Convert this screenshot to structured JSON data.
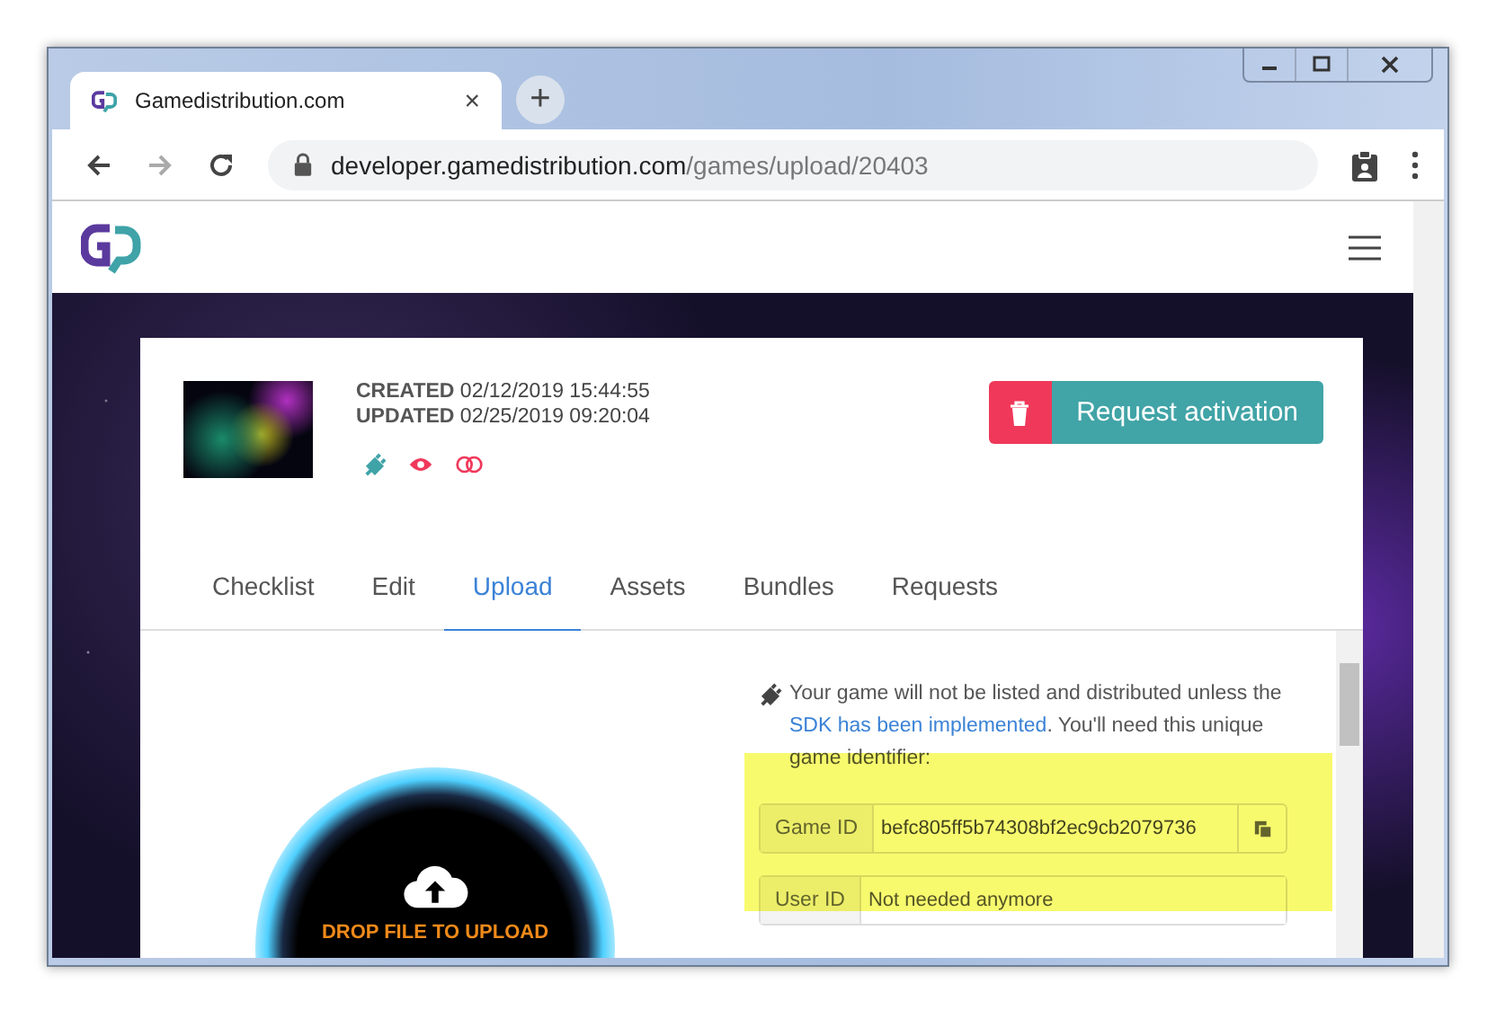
{
  "browser": {
    "tab_title": "Gamedistribution.com",
    "tab_close": "×",
    "new_tab": "+",
    "url_host": "developer.gamedistribution.com",
    "url_path": "/games/upload/20403"
  },
  "game": {
    "created_label": "CREATED",
    "created": "02/12/2019 15:44:55",
    "updated_label": "UPDATED",
    "updated": "02/25/2019 09:20:04",
    "request_button": "Request activation"
  },
  "tabs": [
    {
      "label": "Checklist",
      "selected": false
    },
    {
      "label": "Edit",
      "selected": false
    },
    {
      "label": "Upload",
      "selected": true
    },
    {
      "label": "Assets",
      "selected": false
    },
    {
      "label": "Bundles",
      "selected": false
    },
    {
      "label": "Requests",
      "selected": false
    }
  ],
  "upload": {
    "drop_text": "DROP FILE TO UPLOAD"
  },
  "sdk_notice": {
    "before": "Your game will not be listed and distributed unless the ",
    "link": "SDK has been implemented",
    "after": ". You'll need this unique game identifier:"
  },
  "fields": [
    {
      "kind": "copy",
      "label": "Game ID",
      "value": "befc805ff5b74308bf2ec9cb2079736"
    },
    {
      "kind": "plain",
      "label": "User ID",
      "placeholder": "Not needed anymore"
    }
  ]
}
